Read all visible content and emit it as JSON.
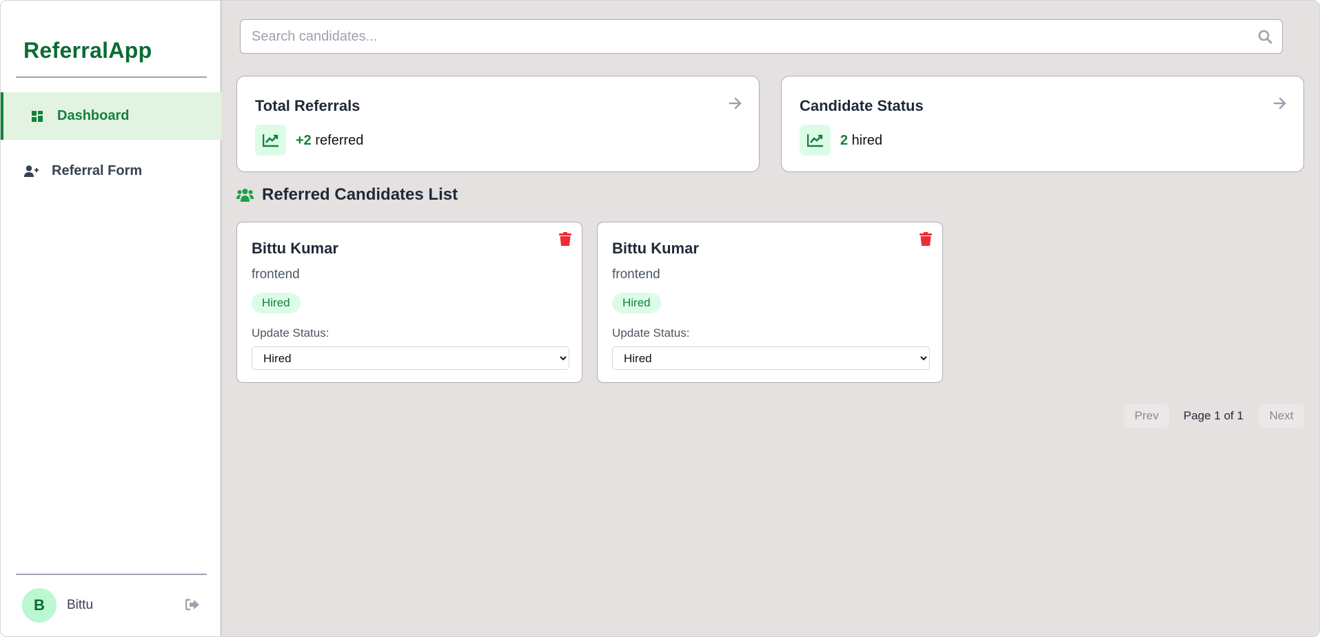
{
  "app": {
    "title": "ReferralApp"
  },
  "sidebar": {
    "items": [
      {
        "label": "Dashboard",
        "icon": "dashboard-icon",
        "active": true
      },
      {
        "label": "Referral Form",
        "icon": "user-plus-icon",
        "active": false
      }
    ],
    "user": {
      "initial": "B",
      "name": "Bittu"
    }
  },
  "search": {
    "placeholder": "Search candidates...",
    "value": ""
  },
  "stats": [
    {
      "title": "Total Referrals",
      "value": "+2",
      "suffix": " referred"
    },
    {
      "title": "Candidate Status",
      "value": "2",
      "suffix": " hired"
    }
  ],
  "section": {
    "title": "Referred Candidates List"
  },
  "candidates": [
    {
      "name": "Bittu Kumar",
      "role": "frontend",
      "status": "Hired",
      "update_label": "Update Status:",
      "selected": "Hired"
    },
    {
      "name": "Bittu Kumar",
      "role": "frontend",
      "status": "Hired",
      "update_label": "Update Status:",
      "selected": "Hired"
    }
  ],
  "pagination": {
    "prev": "Prev",
    "info": "Page 1 of 1",
    "next": "Next"
  },
  "colors": {
    "accent": "#15803d",
    "brand": "#0b6b35",
    "danger": "#ef2b35",
    "background": "#e5e1e0"
  }
}
